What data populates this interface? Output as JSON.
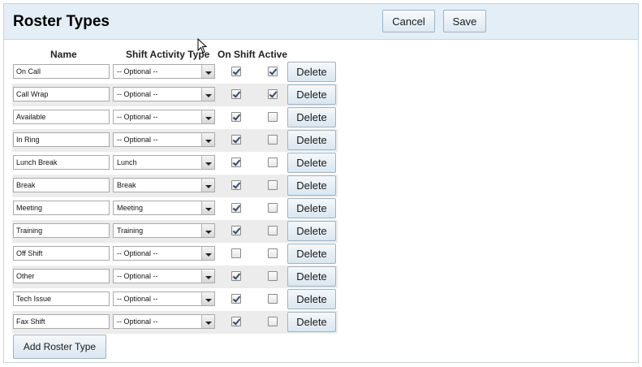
{
  "header": {
    "title": "Roster Types",
    "cancel_label": "Cancel",
    "save_label": "Save"
  },
  "columns": {
    "name": "Name",
    "shift_activity_type": "Shift Activity Type",
    "on_shift": "On Shift",
    "active": "Active"
  },
  "rows": [
    {
      "name": "On Call",
      "activity": "-- Optional --",
      "on_shift": true,
      "active": true
    },
    {
      "name": "Call Wrap",
      "activity": "-- Optional --",
      "on_shift": true,
      "active": true
    },
    {
      "name": "Available",
      "activity": "-- Optional --",
      "on_shift": true,
      "active": false
    },
    {
      "name": "In Ring",
      "activity": "-- Optional --",
      "on_shift": true,
      "active": false
    },
    {
      "name": "Lunch Break",
      "activity": "Lunch",
      "on_shift": true,
      "active": false
    },
    {
      "name": "Break",
      "activity": "Break",
      "on_shift": true,
      "active": false
    },
    {
      "name": "Meeting",
      "activity": "Meeting",
      "on_shift": true,
      "active": false
    },
    {
      "name": "Training",
      "activity": "Training",
      "on_shift": true,
      "active": false
    },
    {
      "name": "Off Shift",
      "activity": "-- Optional --",
      "on_shift": false,
      "active": false
    },
    {
      "name": "Other",
      "activity": "-- Optional --",
      "on_shift": true,
      "active": false
    },
    {
      "name": "Tech Issue",
      "activity": "-- Optional --",
      "on_shift": true,
      "active": false
    },
    {
      "name": "Fax Shift",
      "activity": "-- Optional --",
      "on_shift": true,
      "active": false
    }
  ],
  "row_action_label": "Delete",
  "add_label": "Add Roster Type"
}
